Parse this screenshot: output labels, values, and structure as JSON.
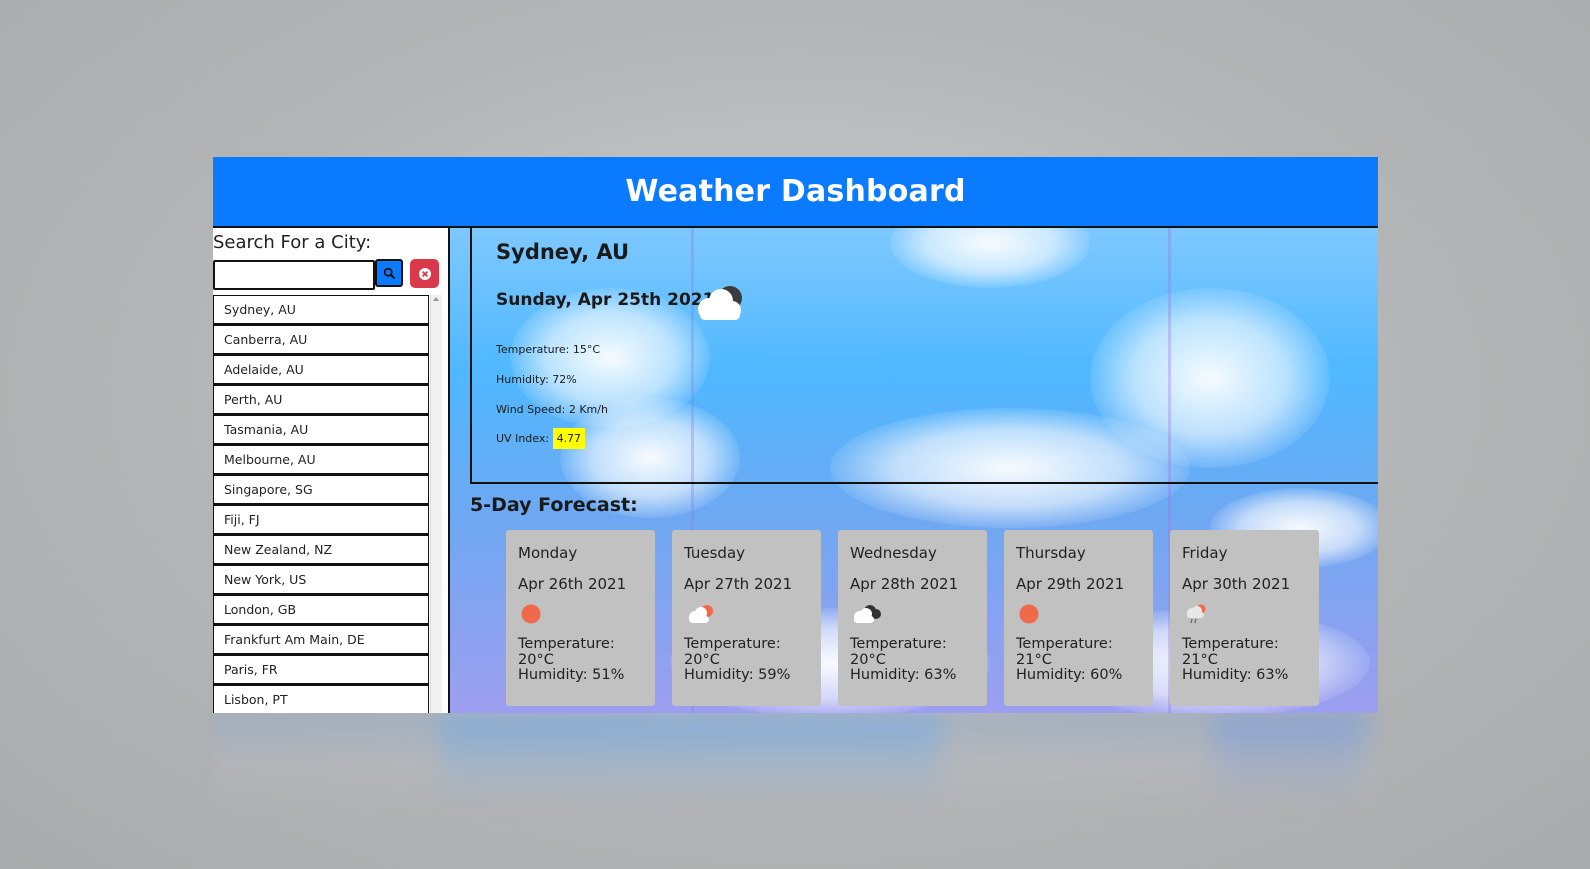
{
  "header": {
    "title": "Weather Dashboard"
  },
  "sidebar": {
    "title": "Search For a City:",
    "search": {
      "placeholder": "",
      "value": ""
    },
    "cities": [
      "Sydney, AU",
      "Canberra, AU",
      "Adelaide, AU",
      "Perth, AU",
      "Tasmania, AU",
      "Melbourne, AU",
      "Singapore, SG",
      "Fiji, FJ",
      "New Zealand, NZ",
      "New York, US",
      "London, GB",
      "Frankfurt Am Main, DE",
      "Paris, FR",
      "Lisbon, PT"
    ]
  },
  "current": {
    "city": "Sydney, AU",
    "date": "Sunday, Apr 25th 2021",
    "icon": "cloud-night-icon",
    "temperature": "Temperature: 15°C",
    "humidity": "Humidity: 72%",
    "wind": "Wind Speed: 2 Km/h",
    "uv_label": "UV Index:",
    "uv_value": "4.77"
  },
  "forecast": {
    "title": "5-Day Forecast:",
    "days": [
      {
        "day": "Monday",
        "date": "Apr 26th 2021",
        "icon": "sun-icon",
        "temp": "Temperature: 20°C",
        "humidity": "Humidity: 51%"
      },
      {
        "day": "Tuesday",
        "date": "Apr 27th 2021",
        "icon": "partly-cloudy-icon",
        "temp": "Temperature: 20°C",
        "humidity": "Humidity: 59%"
      },
      {
        "day": "Wednesday",
        "date": "Apr 28th 2021",
        "icon": "broken-clouds-icon",
        "temp": "Temperature: 20°C",
        "humidity": "Humidity: 63%"
      },
      {
        "day": "Thursday",
        "date": "Apr 29th 2021",
        "icon": "sun-icon",
        "temp": "Temperature: 21°C",
        "humidity": "Humidity: 60%"
      },
      {
        "day": "Friday",
        "date": "Apr 30th 2021",
        "icon": "rain-icon",
        "temp": "Temperature: 21°C",
        "humidity": "Humidity: 63%"
      }
    ]
  },
  "colors": {
    "header": "#0a7bff",
    "search_button": "#0a7bff",
    "clear_button": "#d9394a",
    "uv_highlight": "#ffff00",
    "card": "#c1c1c1",
    "sun": "#f0694a"
  }
}
